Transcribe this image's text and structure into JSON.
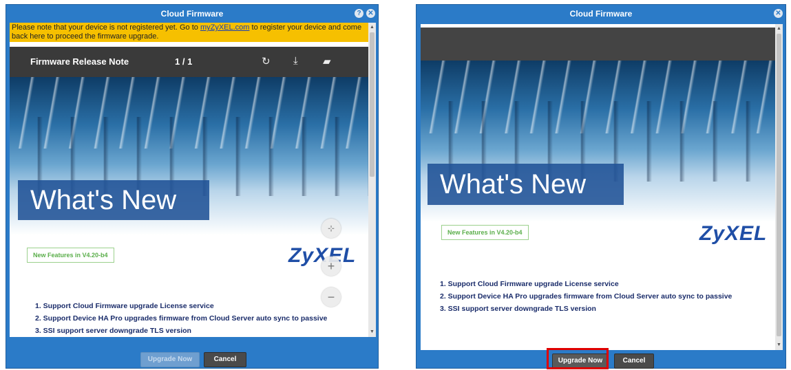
{
  "left_dialog": {
    "title": "Cloud Firmware",
    "help_icon": "help-icon",
    "close_icon": "close-icon",
    "notice": {
      "text_before": "Please note that your device is not registered yet. Go to ",
      "link": "myZyXEL.com",
      "text_after": " to register your device and come back here to proceed the firmware upgrade."
    },
    "toolbar": {
      "title": "Firmware Release Note",
      "page": "1 / 1",
      "icons": [
        "rotate-icon",
        "download-icon",
        "print-icon"
      ]
    },
    "banner": {
      "heading": "What's New",
      "feature_label": "New Features in V4.20-b4",
      "logo": "ZyXEL"
    },
    "features": [
      "1.  Support Cloud Firmware upgrade License service",
      "2.  Support Device HA Pro upgrades firmware from Cloud Server auto sync to passive",
      "3.  SSI support server downgrade TLS version"
    ],
    "zoom": [
      "fit-icon",
      "zoom-in-icon",
      "zoom-out-icon"
    ],
    "buttons": {
      "upgrade": "Upgrade Now",
      "cancel": "Cancel"
    }
  },
  "right_dialog": {
    "title": "Cloud Firmware",
    "close_icon": "close-icon",
    "banner": {
      "heading": "What's New",
      "feature_label": "New Features in V4.20-b4",
      "logo": "ZyXEL"
    },
    "features": [
      "1.  Support Cloud Firmware upgrade License service",
      "2.  Support Device HA Pro upgrades firmware from Cloud Server auto sync to passive",
      "3.  SSI support server downgrade TLS version"
    ],
    "buttons": {
      "upgrade": "Upgrade Now",
      "cancel": "Cancel"
    }
  },
  "colors": {
    "dialog_blue": "#2b7bc8",
    "notice_yellow": "#f6c000",
    "highlight_red": "#e00000",
    "logo_blue": "#1f4ea6",
    "feature_green": "#5aae4a"
  }
}
